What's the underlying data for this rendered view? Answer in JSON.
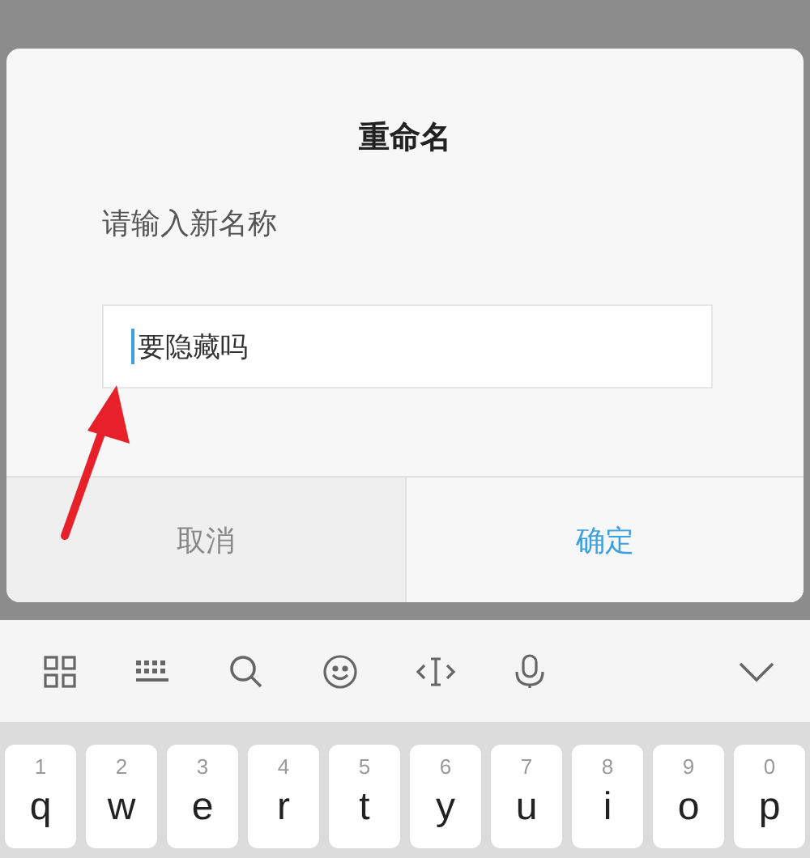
{
  "dialog": {
    "title": "重命名",
    "prompt": "请输入新名称",
    "field": {
      "value": "要隐藏吗"
    },
    "buttons": [
      {
        "label": "取消",
        "primary": false
      },
      {
        "label": "确定",
        "primary": true
      }
    ]
  },
  "keyboard": {
    "keys": [
      {
        "digit": "1",
        "letter": "q"
      },
      {
        "digit": "2",
        "letter": "w"
      },
      {
        "digit": "3",
        "letter": "e"
      },
      {
        "digit": "4",
        "letter": "r"
      },
      {
        "digit": "5",
        "letter": "t"
      },
      {
        "digit": "6",
        "letter": "y"
      },
      {
        "digit": "7",
        "letter": "u"
      },
      {
        "digit": "8",
        "letter": "i"
      },
      {
        "digit": "9",
        "letter": "o"
      },
      {
        "digit": "0",
        "letter": "p"
      }
    ]
  }
}
